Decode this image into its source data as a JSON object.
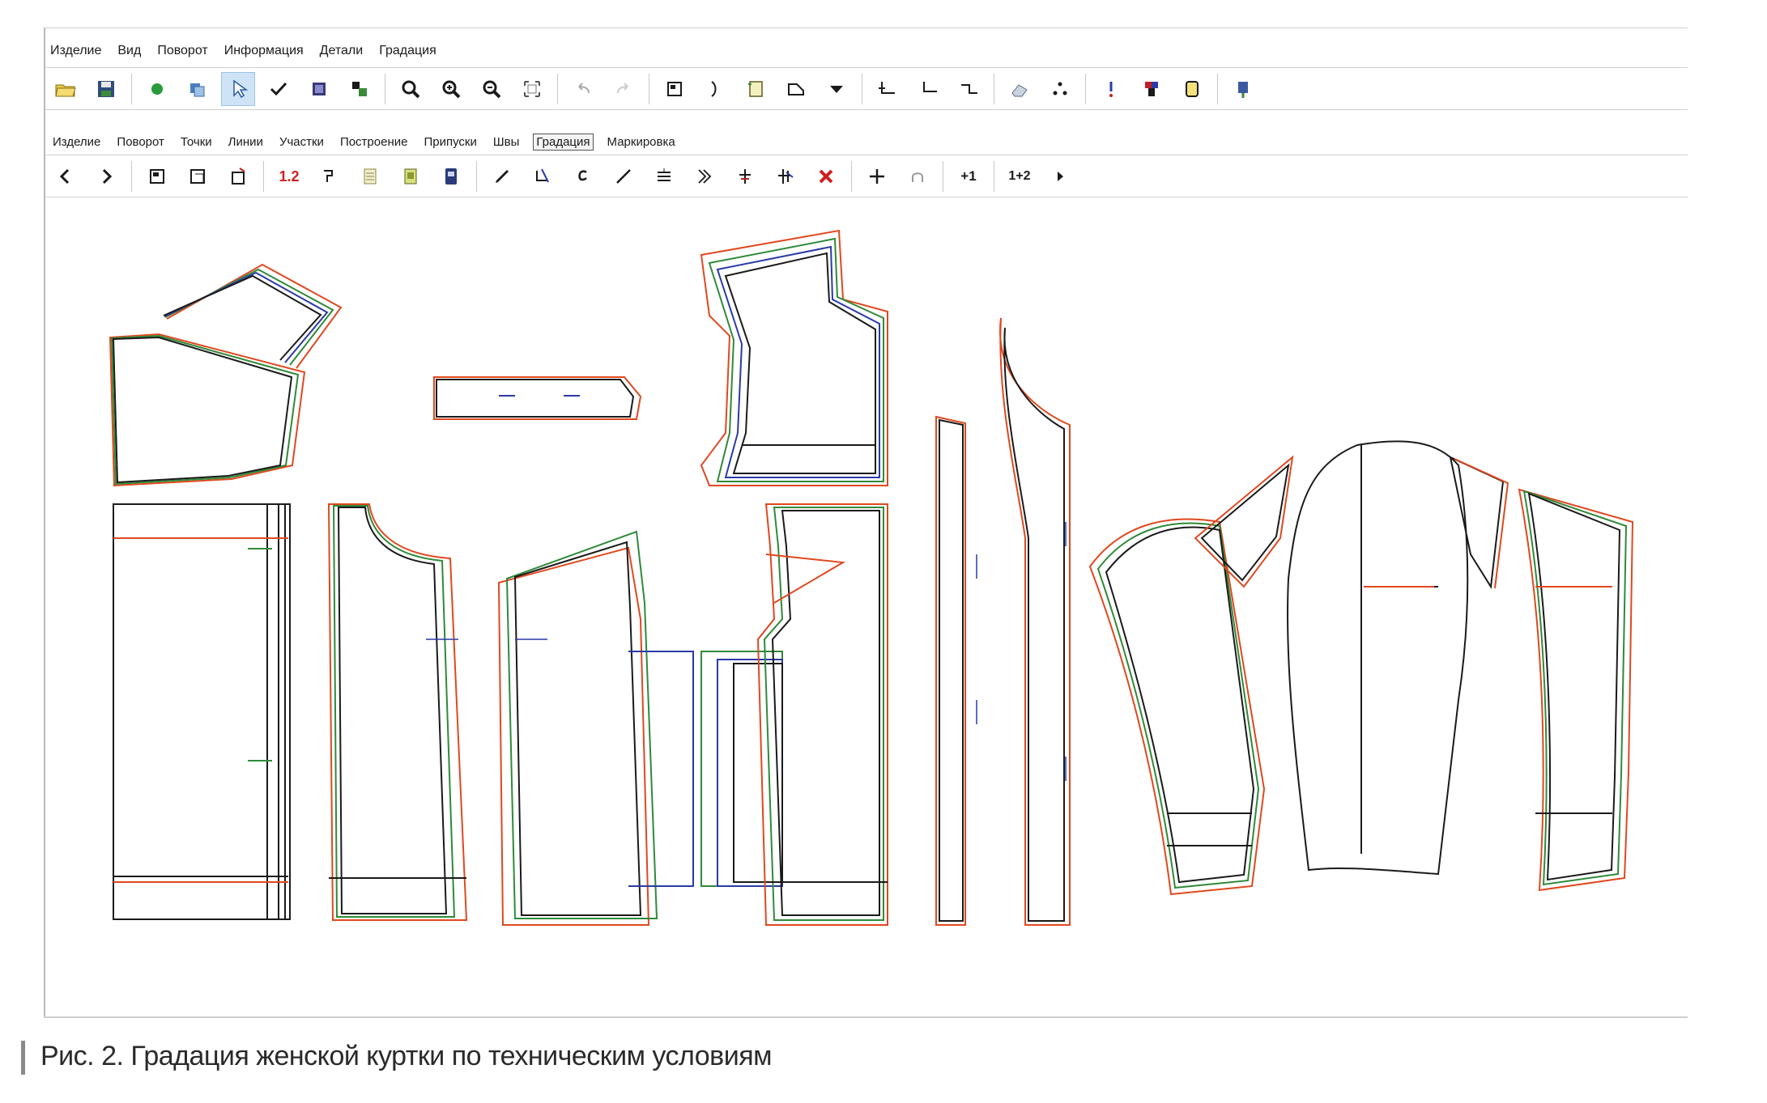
{
  "menu": [
    "Изделие",
    "Вид",
    "Поворот",
    "Информация",
    "Детали",
    "Градация"
  ],
  "tabs": [
    {
      "label": "Изделие",
      "selected": false
    },
    {
      "label": "Поворот",
      "selected": false
    },
    {
      "label": "Точки",
      "selected": false
    },
    {
      "label": "Линии",
      "selected": false
    },
    {
      "label": "Участки",
      "selected": false
    },
    {
      "label": "Построение",
      "selected": false
    },
    {
      "label": "Припуски",
      "selected": false
    },
    {
      "label": "Швы",
      "selected": false
    },
    {
      "label": "Градация",
      "selected": true
    },
    {
      "label": "Маркировка",
      "selected": false
    }
  ],
  "toolbar2": {
    "label_12": "1.2",
    "label_plus1": "+1",
    "label_1plus2": "1+2"
  },
  "caption": "Рис. 2. Градация женской куртки по техническим условиям",
  "colors": {
    "base": "#1a1a1a",
    "size_a": "#e0481f",
    "size_b": "#2f8a3a",
    "size_c": "#2a3aa8"
  }
}
